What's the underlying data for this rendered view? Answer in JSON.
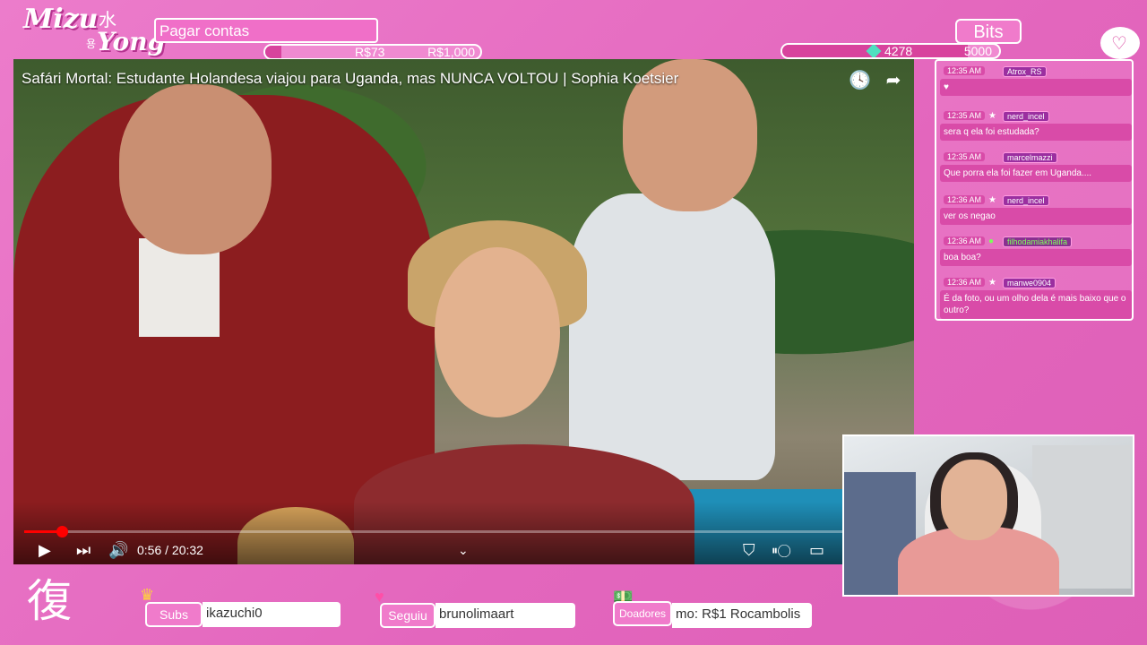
{
  "logo": {
    "line1": "Mizu",
    "line2": "Yong",
    "kanji": "水",
    "korean": "용"
  },
  "goal": {
    "title": "Pagar contas",
    "current": "R$73",
    "target": "R$1,000",
    "progress": 0.073
  },
  "bits": {
    "label": "Bits",
    "current": "4278",
    "target": "5000",
    "progress": 0.8556
  },
  "video": {
    "title": "Safári Mortal: Estudante Holandesa viajou para Uganda, mas NUNCA VOLTOU | Sophia Koetsier",
    "time": "0:56 / 20:32",
    "progress": 0.0455
  },
  "chat": [
    {
      "time": "12:35 AM",
      "badge": "",
      "user": "Atrox_RS",
      "text": "♥"
    },
    {
      "time": "12:35 AM",
      "badge": "★",
      "user": "nerd_incel",
      "text": "sera q ela foi estudada?"
    },
    {
      "time": "12:35 AM",
      "badge": "",
      "user": "marcelmazzi",
      "text": "Que porra ela foi fazer em Uganda...."
    },
    {
      "time": "12:36 AM",
      "badge": "★",
      "user": "nerd_incel",
      "text": "ver os negao"
    },
    {
      "time": "12:36 AM",
      "badge": "●",
      "user": "filhodamiakhalifa",
      "text": "boa boa?"
    },
    {
      "time": "12:36 AM",
      "badge": "★",
      "user": "manwe0904",
      "text": "É da foto, ou um olho dela é mais baixo que o outro?"
    }
  ],
  "bottom": {
    "seal": "復",
    "subs": {
      "label": "Subs",
      "value": "ikazuchi0"
    },
    "follow": {
      "label": "Seguiu",
      "value": "brunolimaart"
    },
    "donors": {
      "label": "Doadores",
      "value": "mo: R$1   Rocambolis"
    }
  },
  "colors": {
    "background": "#e86fc1",
    "panel": "#d94ba8",
    "accent": "#d8439d"
  }
}
